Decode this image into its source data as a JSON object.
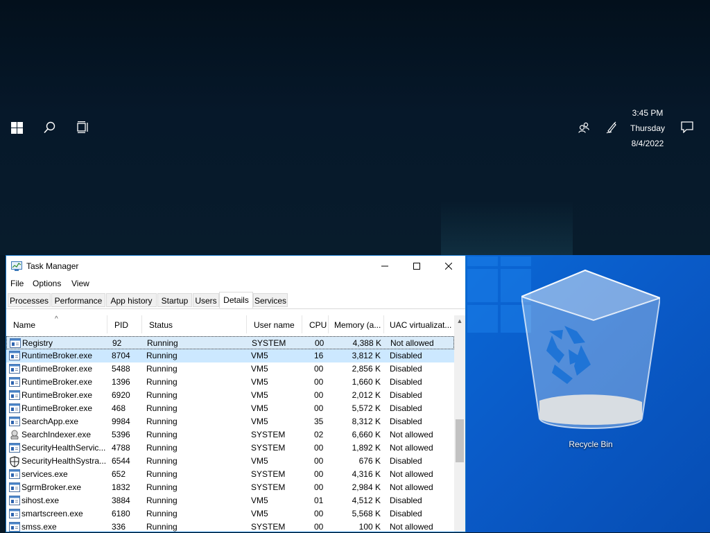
{
  "taskbar": {
    "start_icon": "windows-logo-icon",
    "search_icon": "search-icon",
    "task_view_icon": "task-view-icon",
    "people_icon": "people-icon",
    "pen_icon": "pen-ink-icon",
    "notification_icon": "notification-icon",
    "clock": {
      "time": "3:45 PM",
      "day": "Thursday",
      "date": "8/4/2022"
    }
  },
  "desktop": {
    "recycle_bin_label": "Recycle Bin",
    "accent": "#0a68d6"
  },
  "task_manager": {
    "title": "Task Manager",
    "menu": [
      "File",
      "Options",
      "View"
    ],
    "tabs": [
      "Processes",
      "Performance",
      "App history",
      "Startup",
      "Users",
      "Details",
      "Services"
    ],
    "active_tab": "Details",
    "columns": [
      "Name",
      "PID",
      "Status",
      "User name",
      "CPU",
      "Memory (a...",
      "UAC virtualizat..."
    ],
    "rows": [
      {
        "name": "Registry",
        "pid": "92",
        "status": "Running",
        "user": "SYSTEM",
        "cpu": "00",
        "mem": "4,388 K",
        "uac": "Not allowed",
        "icon": "generic-process-icon"
      },
      {
        "name": "RuntimeBroker.exe",
        "pid": "8704",
        "status": "Running",
        "user": "VM5",
        "cpu": "16",
        "mem": "3,812 K",
        "uac": "Disabled",
        "icon": "generic-process-icon"
      },
      {
        "name": "RuntimeBroker.exe",
        "pid": "5488",
        "status": "Running",
        "user": "VM5",
        "cpu": "00",
        "mem": "2,856 K",
        "uac": "Disabled",
        "icon": "generic-process-icon"
      },
      {
        "name": "RuntimeBroker.exe",
        "pid": "1396",
        "status": "Running",
        "user": "VM5",
        "cpu": "00",
        "mem": "1,660 K",
        "uac": "Disabled",
        "icon": "generic-process-icon"
      },
      {
        "name": "RuntimeBroker.exe",
        "pid": "6920",
        "status": "Running",
        "user": "VM5",
        "cpu": "00",
        "mem": "2,012 K",
        "uac": "Disabled",
        "icon": "generic-process-icon"
      },
      {
        "name": "RuntimeBroker.exe",
        "pid": "468",
        "status": "Running",
        "user": "VM5",
        "cpu": "00",
        "mem": "5,572 K",
        "uac": "Disabled",
        "icon": "generic-process-icon"
      },
      {
        "name": "SearchApp.exe",
        "pid": "9984",
        "status": "Running",
        "user": "VM5",
        "cpu": "35",
        "mem": "8,312 K",
        "uac": "Disabled",
        "icon": "generic-process-icon"
      },
      {
        "name": "SearchIndexer.exe",
        "pid": "5396",
        "status": "Running",
        "user": "SYSTEM",
        "cpu": "02",
        "mem": "6,660 K",
        "uac": "Not allowed",
        "icon": "search-indexer-icon"
      },
      {
        "name": "SecurityHealthServic...",
        "pid": "4788",
        "status": "Running",
        "user": "SYSTEM",
        "cpu": "00",
        "mem": "1,892 K",
        "uac": "Not allowed",
        "icon": "generic-process-icon"
      },
      {
        "name": "SecurityHealthSystra...",
        "pid": "6544",
        "status": "Running",
        "user": "VM5",
        "cpu": "00",
        "mem": "676 K",
        "uac": "Disabled",
        "icon": "shield-icon"
      },
      {
        "name": "services.exe",
        "pid": "652",
        "status": "Running",
        "user": "SYSTEM",
        "cpu": "00",
        "mem": "4,316 K",
        "uac": "Not allowed",
        "icon": "generic-process-icon"
      },
      {
        "name": "SgrmBroker.exe",
        "pid": "1832",
        "status": "Running",
        "user": "SYSTEM",
        "cpu": "00",
        "mem": "2,984 K",
        "uac": "Not allowed",
        "icon": "generic-process-icon"
      },
      {
        "name": "sihost.exe",
        "pid": "3884",
        "status": "Running",
        "user": "VM5",
        "cpu": "01",
        "mem": "4,512 K",
        "uac": "Disabled",
        "icon": "generic-process-icon"
      },
      {
        "name": "smartscreen.exe",
        "pid": "6180",
        "status": "Running",
        "user": "VM5",
        "cpu": "00",
        "mem": "5,568 K",
        "uac": "Disabled",
        "icon": "generic-process-icon"
      },
      {
        "name": "smss.exe",
        "pid": "336",
        "status": "Running",
        "user": "SYSTEM",
        "cpu": "00",
        "mem": "100 K",
        "uac": "Not allowed",
        "icon": "generic-process-icon"
      }
    ]
  }
}
